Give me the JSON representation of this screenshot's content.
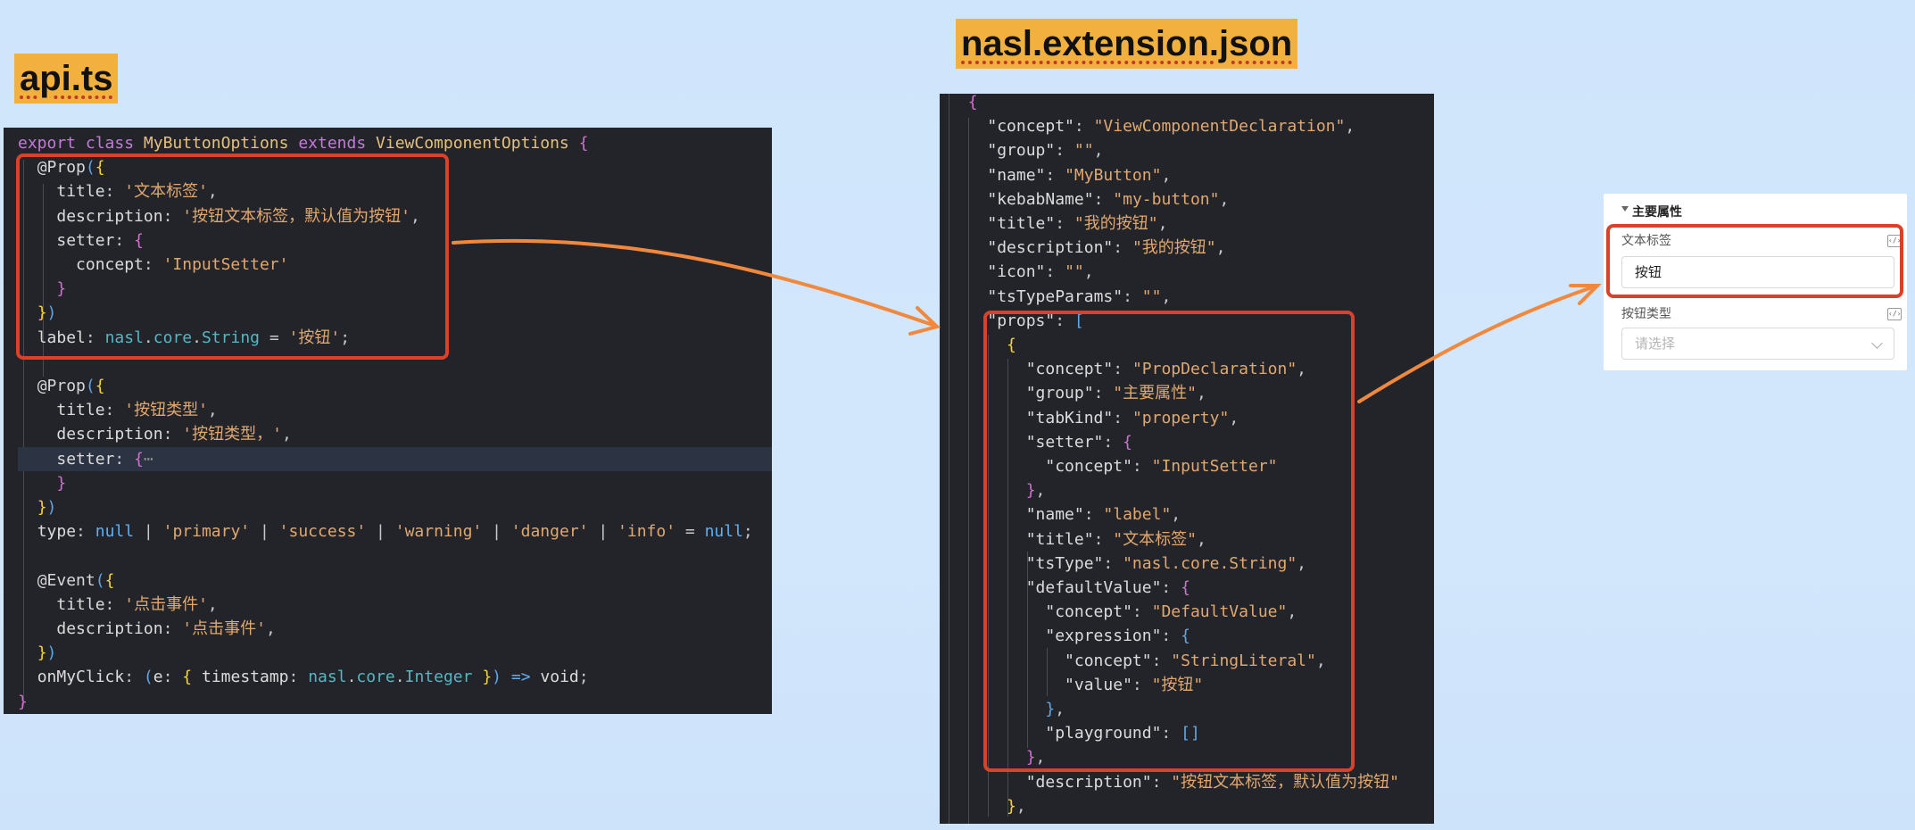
{
  "labels": {
    "api": "api.ts",
    "json": "nasl.extension.json"
  },
  "api_code": [
    [
      [
        "kw",
        "export"
      ],
      [
        "op",
        " "
      ],
      [
        "kw",
        "class"
      ],
      [
        "op",
        " "
      ],
      [
        "cls",
        "MyButtonOptions"
      ],
      [
        "op",
        " "
      ],
      [
        "kw",
        "extends"
      ],
      [
        "op",
        " "
      ],
      [
        "cls",
        "ViewComponentOptions"
      ],
      [
        "op",
        " "
      ],
      [
        "br2",
        "{"
      ]
    ],
    [
      [
        "op",
        "  "
      ],
      [
        "prop",
        "@Prop"
      ],
      [
        "br3",
        "("
      ],
      [
        "br1",
        "{"
      ]
    ],
    [
      [
        "op",
        "    "
      ],
      [
        "key",
        "title"
      ],
      [
        "op",
        ": "
      ],
      [
        "str",
        "'文本标签'"
      ],
      [
        "op",
        ","
      ]
    ],
    [
      [
        "op",
        "    "
      ],
      [
        "key",
        "description"
      ],
      [
        "op",
        ": "
      ],
      [
        "str",
        "'按钮文本标签，默认值为按钮'"
      ],
      [
        "op",
        ","
      ]
    ],
    [
      [
        "op",
        "    "
      ],
      [
        "key",
        "setter"
      ],
      [
        "op",
        ": "
      ],
      [
        "br2",
        "{"
      ]
    ],
    [
      [
        "op",
        "      "
      ],
      [
        "key",
        "concept"
      ],
      [
        "op",
        ": "
      ],
      [
        "str",
        "'InputSetter'"
      ]
    ],
    [
      [
        "op",
        "    "
      ],
      [
        "br2",
        "}"
      ]
    ],
    [
      [
        "op",
        "  "
      ],
      [
        "br1",
        "}"
      ],
      [
        "br3",
        ")"
      ]
    ],
    [
      [
        "op",
        "  "
      ],
      [
        "key",
        "label"
      ],
      [
        "op",
        ": "
      ],
      [
        "null",
        "nasl"
      ],
      [
        "op",
        "."
      ],
      [
        "null",
        "core"
      ],
      [
        "op",
        "."
      ],
      [
        "null",
        "String"
      ],
      [
        "op",
        " = "
      ],
      [
        "str",
        "'按钮'"
      ],
      [
        "op",
        ";"
      ]
    ],
    [],
    [
      [
        "op",
        "  "
      ],
      [
        "prop",
        "@Prop"
      ],
      [
        "br3",
        "("
      ],
      [
        "br1",
        "{"
      ]
    ],
    [
      [
        "op",
        "    "
      ],
      [
        "key",
        "title"
      ],
      [
        "op",
        ": "
      ],
      [
        "str",
        "'按钮类型'"
      ],
      [
        "op",
        ","
      ]
    ],
    [
      [
        "op",
        "    "
      ],
      [
        "key",
        "description"
      ],
      [
        "op",
        ": "
      ],
      [
        "str",
        "'按钮类型，'"
      ],
      [
        "op",
        ","
      ]
    ],
    [
      [
        "op",
        "    "
      ],
      [
        "key",
        "setter"
      ],
      [
        "op",
        ": "
      ],
      [
        "br2",
        "{"
      ],
      [
        "dim",
        "⋯"
      ]
    ],
    [
      [
        "op",
        "    "
      ],
      [
        "br2",
        "}"
      ]
    ],
    [
      [
        "op",
        "  "
      ],
      [
        "br1",
        "}"
      ],
      [
        "br3",
        ")"
      ]
    ],
    [
      [
        "op",
        "  "
      ],
      [
        "key",
        "type"
      ],
      [
        "op",
        ": "
      ],
      [
        "fn",
        "null"
      ],
      [
        "op",
        " | "
      ],
      [
        "str",
        "'primary'"
      ],
      [
        "op",
        " | "
      ],
      [
        "str",
        "'success'"
      ],
      [
        "op",
        " | "
      ],
      [
        "str",
        "'warning'"
      ],
      [
        "op",
        " | "
      ],
      [
        "str",
        "'danger'"
      ],
      [
        "op",
        " | "
      ],
      [
        "str",
        "'info'"
      ],
      [
        "op",
        " = "
      ],
      [
        "fn",
        "null"
      ],
      [
        "op",
        ";"
      ]
    ],
    [],
    [
      [
        "op",
        "  "
      ],
      [
        "prop",
        "@Event"
      ],
      [
        "br3",
        "("
      ],
      [
        "br1",
        "{"
      ]
    ],
    [
      [
        "op",
        "    "
      ],
      [
        "key",
        "title"
      ],
      [
        "op",
        ": "
      ],
      [
        "str",
        "'点击事件'"
      ],
      [
        "op",
        ","
      ]
    ],
    [
      [
        "op",
        "    "
      ],
      [
        "key",
        "description"
      ],
      [
        "op",
        ": "
      ],
      [
        "str",
        "'点击事件'"
      ],
      [
        "op",
        ","
      ]
    ],
    [
      [
        "op",
        "  "
      ],
      [
        "br1",
        "}"
      ],
      [
        "br3",
        ")"
      ]
    ],
    [
      [
        "op",
        "  "
      ],
      [
        "key",
        "onMyClick"
      ],
      [
        "op",
        ": "
      ],
      [
        "br3",
        "("
      ],
      [
        "key",
        "e"
      ],
      [
        "op",
        ": "
      ],
      [
        "br1",
        "{"
      ],
      [
        "op",
        " "
      ],
      [
        "key",
        "timestamp"
      ],
      [
        "op",
        ": "
      ],
      [
        "null",
        "nasl"
      ],
      [
        "op",
        "."
      ],
      [
        "null",
        "core"
      ],
      [
        "op",
        "."
      ],
      [
        "null",
        "Integer"
      ],
      [
        "op",
        " "
      ],
      [
        "br1",
        "}"
      ],
      [
        "br3",
        ")"
      ],
      [
        "op",
        " "
      ],
      [
        "fn",
        "=>"
      ],
      [
        "op",
        " "
      ],
      [
        "key",
        "void"
      ],
      [
        "op",
        ";"
      ]
    ],
    [
      [
        "br2",
        "}"
      ]
    ]
  ],
  "json_code": [
    [
      [
        "op",
        "  "
      ],
      [
        "br2",
        "{"
      ]
    ],
    [
      [
        "op",
        "    "
      ],
      [
        "str2",
        "\"concept\""
      ],
      [
        "op",
        ": "
      ],
      [
        "str",
        "\"ViewComponentDeclaration\""
      ],
      [
        "op",
        ","
      ]
    ],
    [
      [
        "op",
        "    "
      ],
      [
        "str2",
        "\"group\""
      ],
      [
        "op",
        ": "
      ],
      [
        "str",
        "\"\""
      ],
      [
        "op",
        ","
      ]
    ],
    [
      [
        "op",
        "    "
      ],
      [
        "str2",
        "\"name\""
      ],
      [
        "op",
        ": "
      ],
      [
        "str",
        "\"MyButton\""
      ],
      [
        "op",
        ","
      ]
    ],
    [
      [
        "op",
        "    "
      ],
      [
        "str2",
        "\"kebabName\""
      ],
      [
        "op",
        ": "
      ],
      [
        "str",
        "\"my-button\""
      ],
      [
        "op",
        ","
      ]
    ],
    [
      [
        "op",
        "    "
      ],
      [
        "str2",
        "\"title\""
      ],
      [
        "op",
        ": "
      ],
      [
        "str",
        "\"我的按钮\""
      ],
      [
        "op",
        ","
      ]
    ],
    [
      [
        "op",
        "    "
      ],
      [
        "str2",
        "\"description\""
      ],
      [
        "op",
        ": "
      ],
      [
        "str",
        "\"我的按钮\""
      ],
      [
        "op",
        ","
      ]
    ],
    [
      [
        "op",
        "    "
      ],
      [
        "str2",
        "\"icon\""
      ],
      [
        "op",
        ": "
      ],
      [
        "str",
        "\"\""
      ],
      [
        "op",
        ","
      ]
    ],
    [
      [
        "op",
        "    "
      ],
      [
        "str2",
        "\"tsTypeParams\""
      ],
      [
        "op",
        ": "
      ],
      [
        "str",
        "\"\""
      ],
      [
        "op",
        ","
      ]
    ],
    [
      [
        "op",
        "    "
      ],
      [
        "str2",
        "\"props\""
      ],
      [
        "op",
        ": "
      ],
      [
        "br3",
        "["
      ]
    ],
    [
      [
        "op",
        "      "
      ],
      [
        "br1",
        "{"
      ]
    ],
    [
      [
        "op",
        "        "
      ],
      [
        "str2",
        "\"concept\""
      ],
      [
        "op",
        ": "
      ],
      [
        "str",
        "\"PropDeclaration\""
      ],
      [
        "op",
        ","
      ]
    ],
    [
      [
        "op",
        "        "
      ],
      [
        "str2",
        "\"group\""
      ],
      [
        "op",
        ": "
      ],
      [
        "str",
        "\"主要属性\""
      ],
      [
        "op",
        ","
      ]
    ],
    [
      [
        "op",
        "        "
      ],
      [
        "str2",
        "\"tabKind\""
      ],
      [
        "op",
        ": "
      ],
      [
        "str",
        "\"property\""
      ],
      [
        "op",
        ","
      ]
    ],
    [
      [
        "op",
        "        "
      ],
      [
        "str2",
        "\"setter\""
      ],
      [
        "op",
        ": "
      ],
      [
        "br2",
        "{"
      ]
    ],
    [
      [
        "op",
        "          "
      ],
      [
        "str2",
        "\"concept\""
      ],
      [
        "op",
        ": "
      ],
      [
        "str",
        "\"InputSetter\""
      ]
    ],
    [
      [
        "op",
        "        "
      ],
      [
        "br2",
        "}"
      ],
      [
        "op",
        ","
      ]
    ],
    [
      [
        "op",
        "        "
      ],
      [
        "str2",
        "\"name\""
      ],
      [
        "op",
        ": "
      ],
      [
        "str",
        "\"label\""
      ],
      [
        "op",
        ","
      ]
    ],
    [
      [
        "op",
        "        "
      ],
      [
        "str2",
        "\"title\""
      ],
      [
        "op",
        ": "
      ],
      [
        "str",
        "\"文本标签\""
      ],
      [
        "op",
        ","
      ]
    ],
    [
      [
        "op",
        "        "
      ],
      [
        "str2",
        "\"tsType\""
      ],
      [
        "op",
        ": "
      ],
      [
        "str",
        "\"nasl.core.String\""
      ],
      [
        "op",
        ","
      ]
    ],
    [
      [
        "op",
        "        "
      ],
      [
        "str2",
        "\"defaultValue\""
      ],
      [
        "op",
        ": "
      ],
      [
        "br2",
        "{"
      ]
    ],
    [
      [
        "op",
        "          "
      ],
      [
        "str2",
        "\"concept\""
      ],
      [
        "op",
        ": "
      ],
      [
        "str",
        "\"DefaultValue\""
      ],
      [
        "op",
        ","
      ]
    ],
    [
      [
        "op",
        "          "
      ],
      [
        "str2",
        "\"expression\""
      ],
      [
        "op",
        ": "
      ],
      [
        "br3",
        "{"
      ]
    ],
    [
      [
        "op",
        "            "
      ],
      [
        "str2",
        "\"concept\""
      ],
      [
        "op",
        ": "
      ],
      [
        "str",
        "\"StringLiteral\""
      ],
      [
        "op",
        ","
      ]
    ],
    [
      [
        "op",
        "            "
      ],
      [
        "str2",
        "\"value\""
      ],
      [
        "op",
        ": "
      ],
      [
        "str",
        "\"按钮\""
      ]
    ],
    [
      [
        "op",
        "          "
      ],
      [
        "br3",
        "}"
      ],
      [
        "op",
        ","
      ]
    ],
    [
      [
        "op",
        "          "
      ],
      [
        "str2",
        "\"playground\""
      ],
      [
        "op",
        ": "
      ],
      [
        "br3",
        "[]"
      ]
    ],
    [
      [
        "op",
        "        "
      ],
      [
        "br2",
        "}"
      ],
      [
        "op",
        ","
      ]
    ],
    [
      [
        "op",
        "        "
      ],
      [
        "str2",
        "\"description\""
      ],
      [
        "op",
        ": "
      ],
      [
        "str",
        "\"按钮文本标签，默认值为按钮\""
      ]
    ],
    [
      [
        "op",
        "      "
      ],
      [
        "br1",
        "}"
      ],
      [
        "op",
        ","
      ]
    ]
  ],
  "settings": {
    "group_title": "主要属性",
    "field1_label": "文本标签",
    "field1_value": "按钮",
    "field2_label": "按钮类型",
    "field2_placeholder": "请选择"
  },
  "colors": {
    "label_bg": "#f2b13f",
    "highlight_box": "#d9412b",
    "arrow": "#f0883e",
    "code_bg": "#23242a"
  }
}
